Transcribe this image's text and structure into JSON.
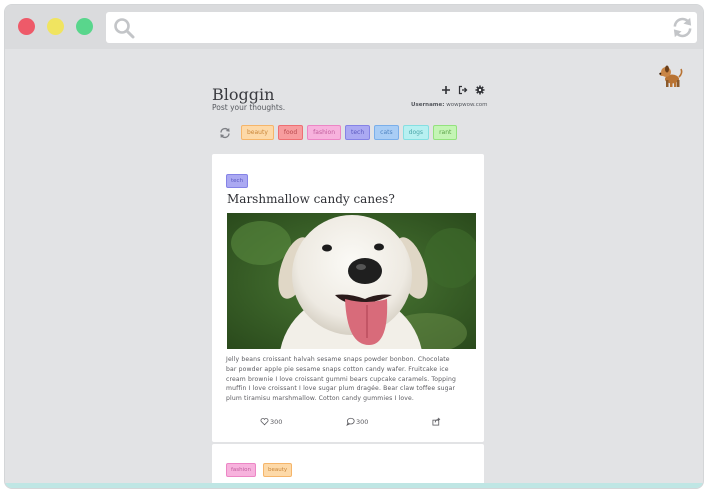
{
  "browser": {
    "window_controls": [
      "close",
      "minimize",
      "maximize"
    ],
    "url_value": "",
    "search_icon": "search-icon",
    "reload_icon": "reload-icon"
  },
  "app": {
    "title": "Bloggin",
    "tagline": "Post your thoughts.",
    "username_label": "Username:",
    "username_value": "wowpwow.com",
    "header_icons": [
      "plus-icon",
      "logout-icon",
      "gear-icon"
    ],
    "avatar_icon": "dog-icon"
  },
  "filters": {
    "refresh_icon": "refresh-icon",
    "tags": [
      {
        "label": "beauty",
        "bg": "#fdd9a8",
        "border": "#f5b56a",
        "color": "#c9863a"
      },
      {
        "label": "food",
        "bg": "#f79c9e",
        "border": "#ee6f73",
        "color": "#b9494e"
      },
      {
        "label": "fashion",
        "bg": "#f7b2dd",
        "border": "#ec86c5",
        "color": "#c05d9d"
      },
      {
        "label": "tech",
        "bg": "#aba9f2",
        "border": "#8583e6",
        "color": "#5b59c0"
      },
      {
        "label": "cats",
        "bg": "#a9cdf5",
        "border": "#7aafea",
        "color": "#4f84c2"
      },
      {
        "label": "dogs",
        "bg": "#b7f0f1",
        "border": "#85dfe2",
        "color": "#4aa5a8"
      },
      {
        "label": "rant",
        "bg": "#c4f5b5",
        "border": "#93e27e",
        "color": "#5ba247"
      }
    ]
  },
  "posts": [
    {
      "tags": [
        {
          "label": "tech",
          "bg": "#aba9f2",
          "border": "#8583e6",
          "color": "#5b59c0"
        }
      ],
      "title": "Marshmallow candy canes?",
      "image": "puppy-photo",
      "body_lines": [
        "Jelly beans croissant halvah sesame snaps powder bonbon. Chocolate",
        "bar powder apple pie sesame snaps cotton candy wafer. Fruitcake ice",
        "cream brownie I love croissant gummi bears cupcake caramels. Topping",
        "muffin I love croissant I love sugar plum dragée. Bear claw toffee sugar",
        "plum tiramisu marshmallow. Cotton candy gummies I love."
      ],
      "likes": "300",
      "comments": "300",
      "share_icon": "share-icon"
    },
    {
      "tags": [
        {
          "label": "fashion",
          "bg": "#f7b2dd",
          "border": "#ec86c5",
          "color": "#c05d9d"
        },
        {
          "label": "beauty",
          "bg": "#fdd9a8",
          "border": "#f5b56a",
          "color": "#c9863a"
        }
      ]
    }
  ]
}
